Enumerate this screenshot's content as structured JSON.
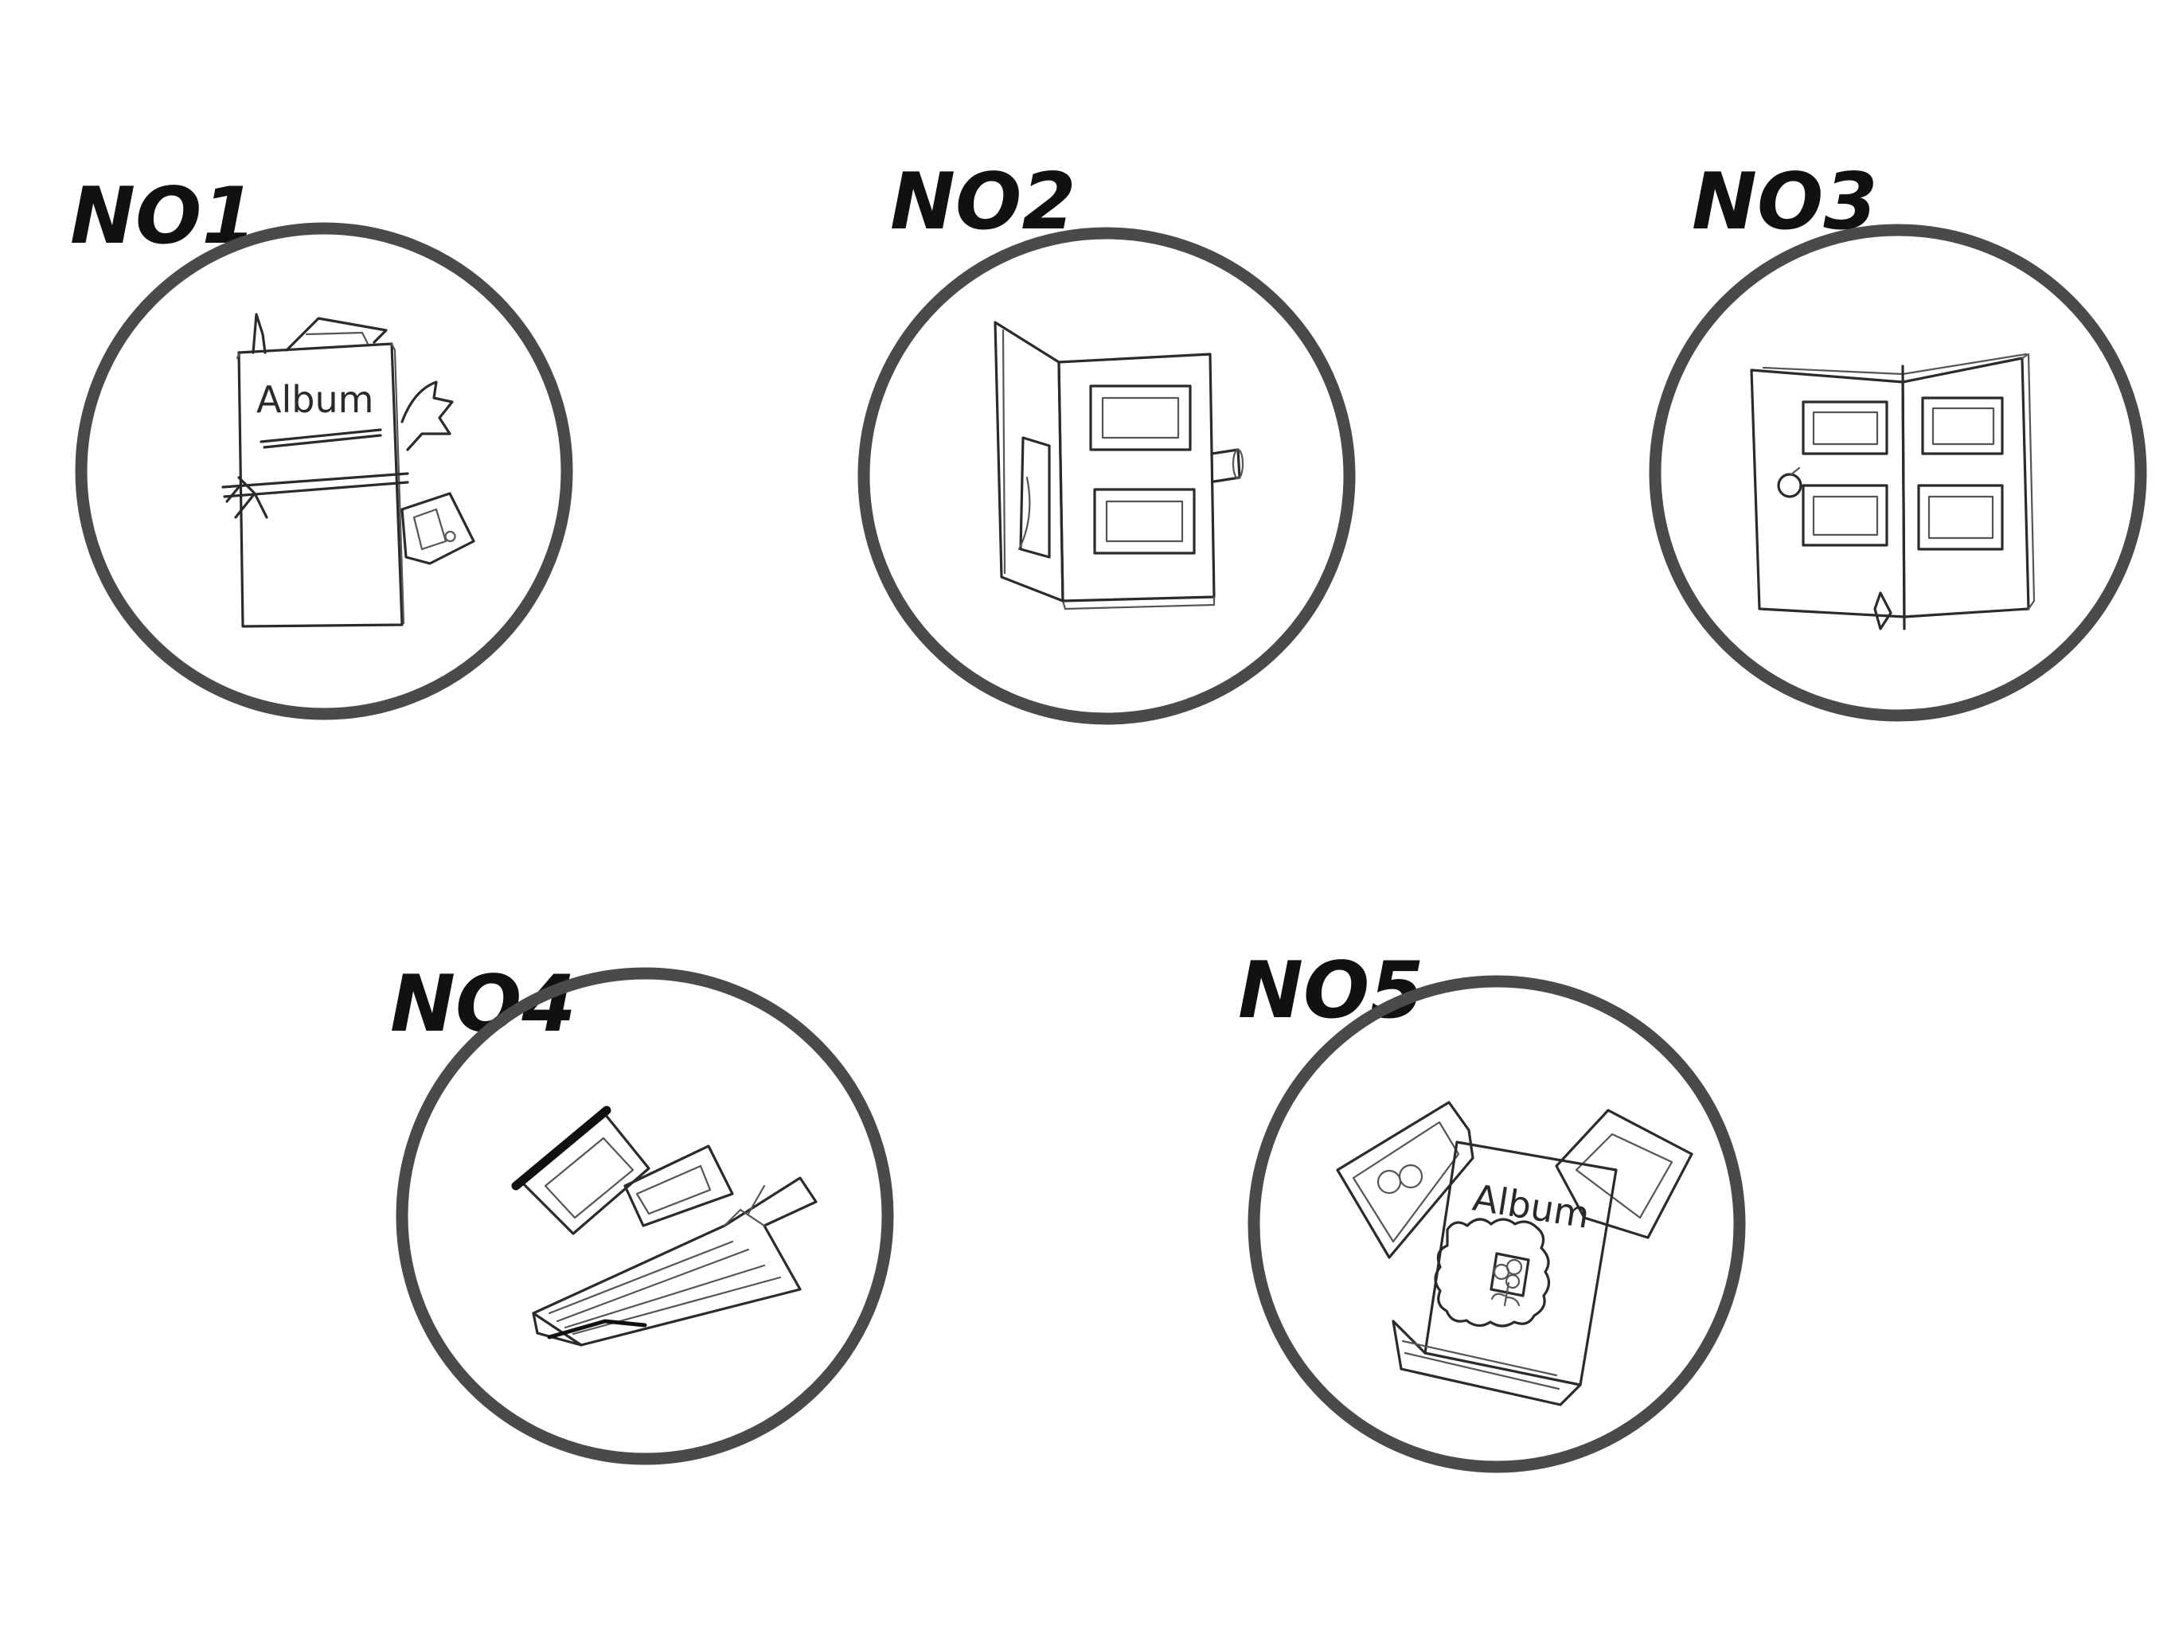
{
  "sketches": [
    {
      "label": "NO1",
      "cover_text": "Album",
      "icon": "bound-album-with-ribbon-icon"
    },
    {
      "label": "NO2",
      "icon": "open-folder-album-icon"
    },
    {
      "label": "NO3",
      "icon": "open-spread-album-icon"
    },
    {
      "label": "NO4",
      "icon": "fanned-photo-book-icon"
    },
    {
      "label": "NO5",
      "cover_text": "Album",
      "icon": "album-box-with-photos-icon"
    }
  ],
  "colors": {
    "ring": "#4a4a4a",
    "ink": "#2b2b2b",
    "label": "#111111",
    "background": "#ffffff"
  }
}
